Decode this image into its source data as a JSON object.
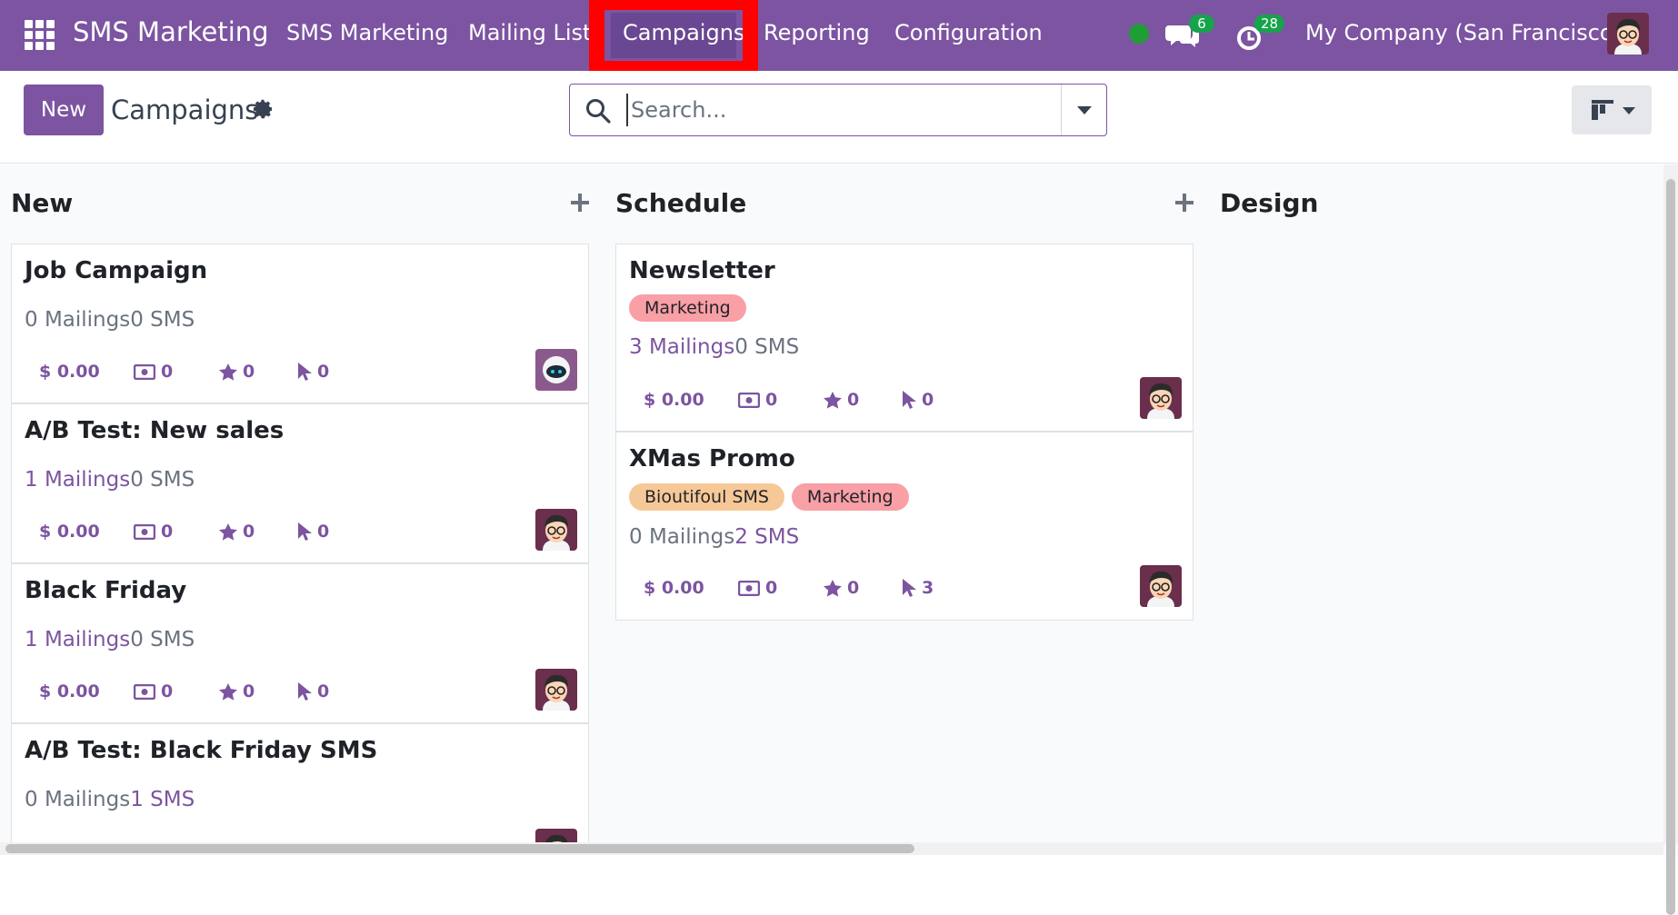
{
  "navbar": {
    "brand": "SMS Marketing",
    "items": [
      {
        "label": "SMS Marketing"
      },
      {
        "label": "Mailing Lists"
      },
      {
        "label": "Campaigns"
      },
      {
        "label": "Reporting"
      },
      {
        "label": "Configuration"
      }
    ],
    "active_item": "Campaigns",
    "messages_count": "6",
    "activities_count": "28",
    "company": "My Company (San Francisco)",
    "accent": "#7c54a1"
  },
  "control": {
    "new_label": "New",
    "title": "Campaigns",
    "search_placeholder": "Search..."
  },
  "columns": [
    {
      "title": "New",
      "cards": [
        {
          "title": "Job Campaign",
          "tags": [],
          "mailings": "0 Mailings",
          "sms": "0 SMS",
          "revenue": "$ 0.00",
          "invoices": "0",
          "opportunities": "0",
          "clicks": "0",
          "avatar": "bot-avatar"
        },
        {
          "title": "A/B Test: New sales",
          "tags": [],
          "mailings": "1 Mailings",
          "sms": "0 SMS",
          "revenue": "$ 0.00",
          "invoices": "0",
          "opportunities": "0",
          "clicks": "0",
          "avatar": "user-avatar"
        },
        {
          "title": "Black Friday",
          "tags": [],
          "mailings": "1 Mailings",
          "sms": "0 SMS",
          "revenue": "$ 0.00",
          "invoices": "0",
          "opportunities": "0",
          "clicks": "0",
          "avatar": "user-avatar"
        },
        {
          "title": "A/B Test: Black Friday SMS",
          "tags": [],
          "mailings": "0 Mailings",
          "sms": "1 SMS",
          "avatar": "user-avatar"
        }
      ]
    },
    {
      "title": "Schedule",
      "cards": [
        {
          "title": "Newsletter",
          "tags": [
            "Marketing"
          ],
          "mailings": "3 Mailings",
          "sms": "0 SMS",
          "revenue": "$ 0.00",
          "invoices": "0",
          "opportunities": "0",
          "clicks": "0",
          "avatar": "user-avatar"
        },
        {
          "title": "XMas Promo",
          "tags": [
            "Bioutifoul SMS",
            "Marketing"
          ],
          "mailings": "0 Mailings",
          "sms": "2 SMS",
          "revenue": "$ 0.00",
          "invoices": "0",
          "opportunities": "0",
          "clicks": "3",
          "avatar": "user-avatar"
        }
      ]
    },
    {
      "title": "Design",
      "cards": []
    }
  ],
  "colors": {
    "tag_marketing": "#f99fa6",
    "tag_bioutifoul": "#f7c897",
    "link": "#7c54a1",
    "highlight": "#ff0000"
  }
}
